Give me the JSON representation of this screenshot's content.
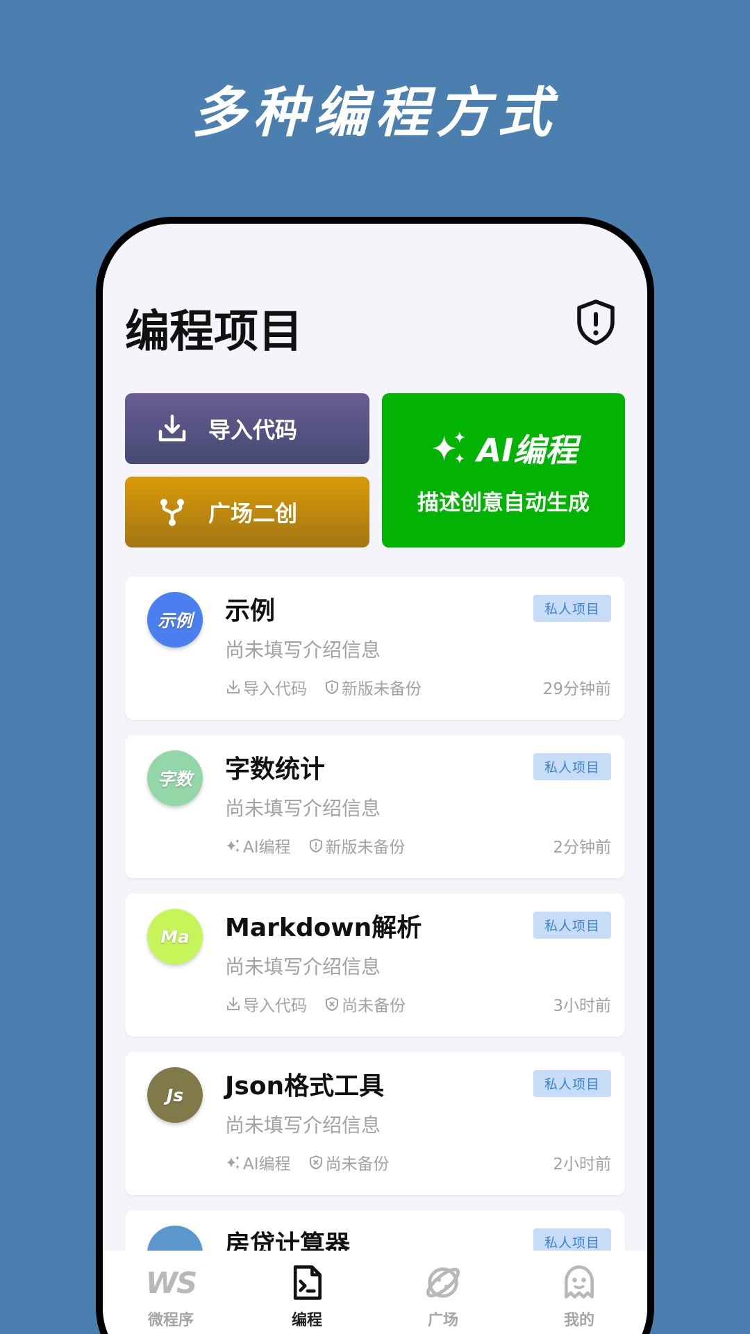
{
  "banner": {
    "title": "多种编程方式"
  },
  "header": {
    "title": "编程项目"
  },
  "actions": {
    "import_label": "导入代码",
    "remix_label": "广场二创",
    "ai_title": "AI编程",
    "ai_subtitle": "描述创意自动生成"
  },
  "projects": [
    {
      "avatar": "示例",
      "avatar_color": "#4b7ff0",
      "name": "示例",
      "badge": "私人项目",
      "desc": "尚未填写介绍信息",
      "source": "导入代码",
      "backup": "新版未备份",
      "time": "29分钟前"
    },
    {
      "avatar": "字数",
      "avatar_color": "#93d6a8",
      "name": "字数统计",
      "badge": "私人项目",
      "desc": "尚未填写介绍信息",
      "source": "AI编程",
      "backup": "新版未备份",
      "time": "2分钟前"
    },
    {
      "avatar": "Ma",
      "avatar_color": "#c6f55a",
      "name": "Markdown解析",
      "badge": "私人项目",
      "desc": "尚未填写介绍信息",
      "source": "导入代码",
      "backup": "尚未备份",
      "time": "3小时前"
    },
    {
      "avatar": "Js",
      "avatar_color": "#807a4a",
      "name": "Json格式工具",
      "badge": "私人项目",
      "desc": "尚未填写介绍信息",
      "source": "AI编程",
      "backup": "尚未备份",
      "time": "2小时前"
    },
    {
      "avatar": "",
      "avatar_color": "#5b96cc",
      "name": "房贷计算器",
      "badge": "私人项目",
      "desc": "",
      "source": "",
      "backup": "",
      "time": ""
    }
  ],
  "tabbar": {
    "items": [
      {
        "label": "微程序",
        "icon": "ws-logo-icon"
      },
      {
        "label": "编程",
        "icon": "code-file-icon"
      },
      {
        "label": "广场",
        "icon": "planet-icon"
      },
      {
        "label": "我的",
        "icon": "ghost-avatar-icon"
      }
    ]
  }
}
